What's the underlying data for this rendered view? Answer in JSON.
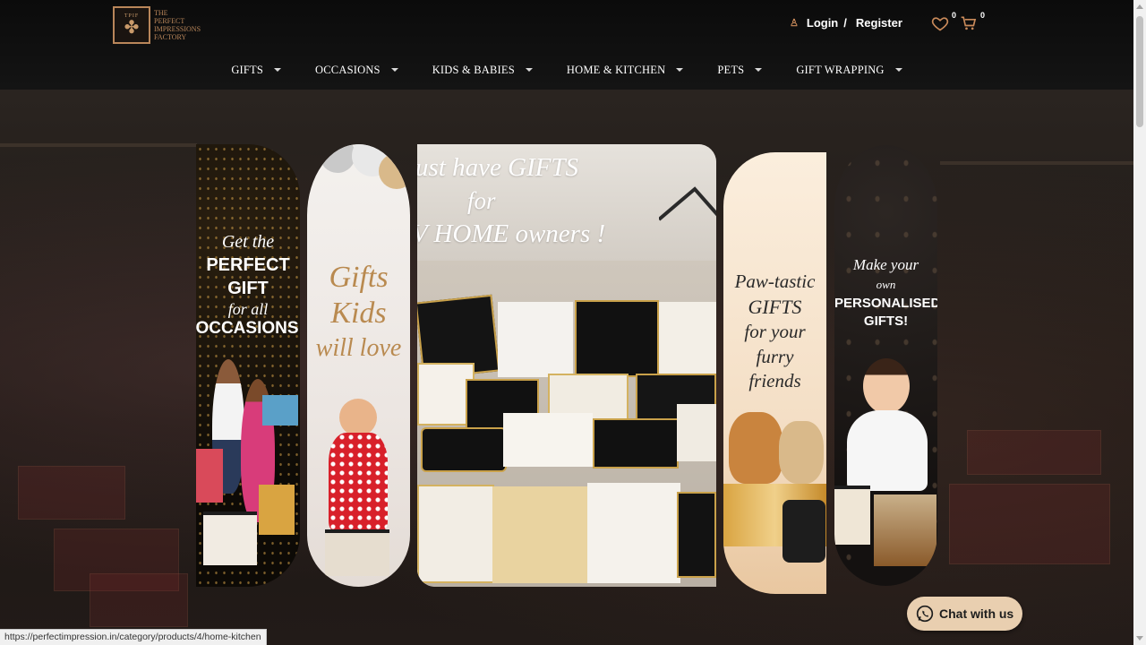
{
  "brand": {
    "mark": "TPIF",
    "name_lines": [
      "THE",
      "PERFECT",
      "IMPRESSIONS",
      "FACTORY"
    ]
  },
  "account": {
    "login": "Login",
    "separator": "/",
    "register": "Register"
  },
  "wishlist": {
    "count": "0"
  },
  "cart": {
    "count": "0"
  },
  "nav": [
    {
      "label": "GIFTS"
    },
    {
      "label": "OCCASIONS"
    },
    {
      "label": "KIDS & BABIES"
    },
    {
      "label": "HOME & KITCHEN"
    },
    {
      "label": "PETS"
    },
    {
      "label": "GIFT WRAPPING"
    }
  ],
  "banners": {
    "occasions": {
      "script": "Get the",
      "line1": "PERFECT",
      "line2": "GIFT",
      "script2": "for all",
      "line3": "OCCASIONS"
    },
    "kids": {
      "line1": "Gifts",
      "line2": "Kids",
      "line3": "will love"
    },
    "home": {
      "line1": "ust have GIFTS",
      "line2": "for",
      "line3": "V HOME owners !"
    },
    "pets": {
      "line1": "Paw-tastic",
      "line2": "GIFTS",
      "line3": "for your",
      "line4": "furry",
      "line5": "friends"
    },
    "personal": {
      "script1": "Make your",
      "script2": "own",
      "line1": "PERSONALISED",
      "line2": "GIFTS!"
    }
  },
  "chat": {
    "label": "Chat with us"
  },
  "status_url": "https://perfectimpression.in/category/products/4/home-kitchen",
  "colors": {
    "accent": "#b9865a",
    "chat_bg": "#e9cfb0",
    "header_bg": "#0b0b0b"
  }
}
